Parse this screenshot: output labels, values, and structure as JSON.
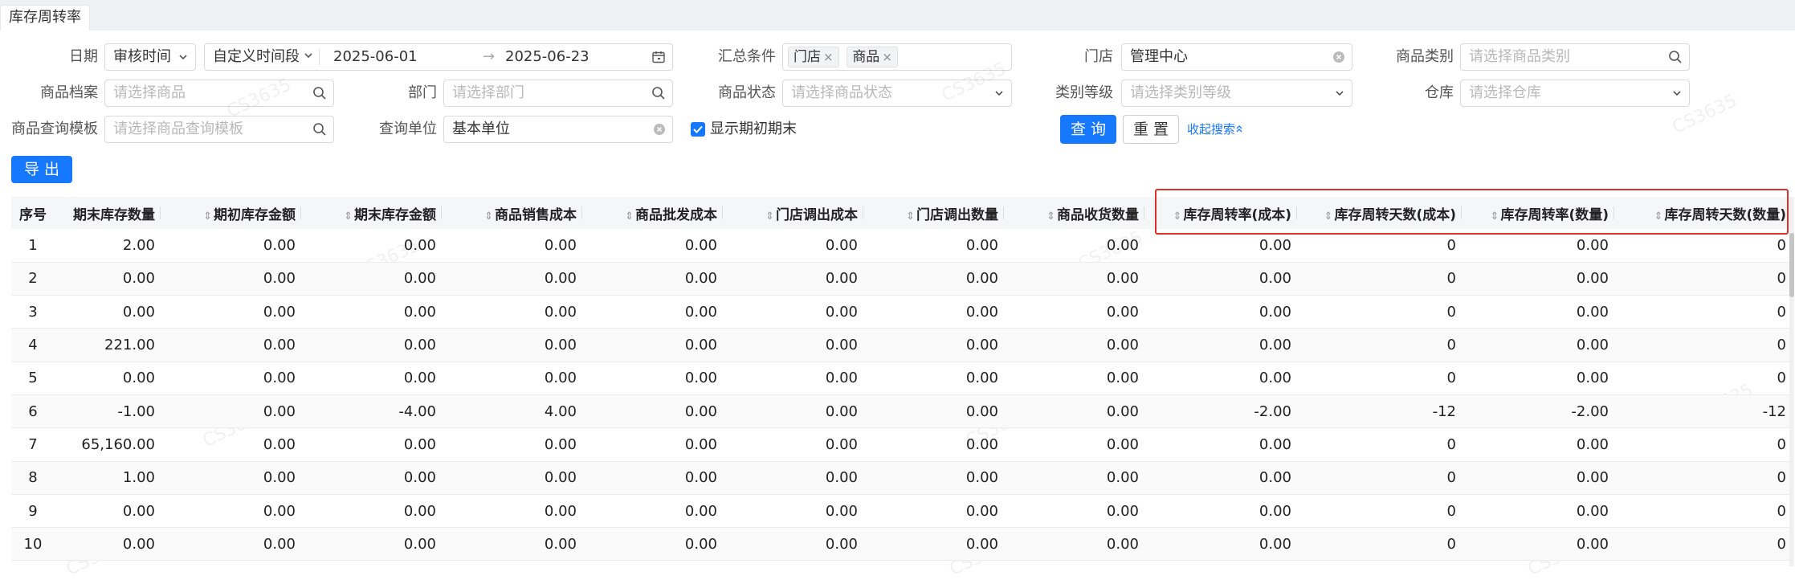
{
  "tab": {
    "title": "库存周转率"
  },
  "filters": {
    "date_label": "日期",
    "date_type": "审核时间",
    "date_range_mode": "自定义时间段",
    "start_date": "2025-06-01",
    "end_date": "2025-06-23",
    "summary_label": "汇总条件",
    "summary_tags": [
      "门店",
      "商品"
    ],
    "store_label": "门店",
    "store_value": "管理中心",
    "category_label": "商品类别",
    "category_placeholder": "请选择商品类别",
    "product_label": "商品档案",
    "product_placeholder": "请选择商品",
    "dept_label": "部门",
    "dept_placeholder": "请选择部门",
    "status_label": "商品状态",
    "status_placeholder": "请选择商品状态",
    "level_label": "类别等级",
    "level_placeholder": "请选择类别等级",
    "warehouse_label": "仓库",
    "warehouse_placeholder": "请选择仓库",
    "template_label": "商品查询模板",
    "template_placeholder": "请选择商品查询模板",
    "unit_label": "查询单位",
    "unit_value": "基本单位",
    "show_period_label": "显示期初期末",
    "show_period_checked": true
  },
  "actions": {
    "query": "查 询",
    "reset": "重 置",
    "collapse": "收起搜索",
    "export": "导 出"
  },
  "table": {
    "columns": [
      "序号",
      "期末库存数量",
      "期初库存金额",
      "期末库存金额",
      "商品销售成本",
      "商品批发成本",
      "门店调出成本",
      "门店调出数量",
      "商品收货数量",
      "库存周转率(成本)",
      "库存周转天数(成本)",
      "库存周转率(数量)",
      "库存周转天数(数量)"
    ],
    "rows": [
      [
        "1",
        "2.00",
        "0.00",
        "0.00",
        "0.00",
        "0.00",
        "0.00",
        "0.00",
        "0.00",
        "0.00",
        "0",
        "0.00",
        "0"
      ],
      [
        "2",
        "0.00",
        "0.00",
        "0.00",
        "0.00",
        "0.00",
        "0.00",
        "0.00",
        "0.00",
        "0.00",
        "0",
        "0.00",
        "0"
      ],
      [
        "3",
        "0.00",
        "0.00",
        "0.00",
        "0.00",
        "0.00",
        "0.00",
        "0.00",
        "0.00",
        "0.00",
        "0",
        "0.00",
        "0"
      ],
      [
        "4",
        "221.00",
        "0.00",
        "0.00",
        "0.00",
        "0.00",
        "0.00",
        "0.00",
        "0.00",
        "0.00",
        "0",
        "0.00",
        "0"
      ],
      [
        "5",
        "0.00",
        "0.00",
        "0.00",
        "0.00",
        "0.00",
        "0.00",
        "0.00",
        "0.00",
        "0.00",
        "0",
        "0.00",
        "0"
      ],
      [
        "6",
        "-1.00",
        "0.00",
        "-4.00",
        "4.00",
        "0.00",
        "0.00",
        "0.00",
        "0.00",
        "-2.00",
        "-12",
        "-2.00",
        "-12"
      ],
      [
        "7",
        "65,160.00",
        "0.00",
        "0.00",
        "0.00",
        "0.00",
        "0.00",
        "0.00",
        "0.00",
        "0.00",
        "0",
        "0.00",
        "0"
      ],
      [
        "8",
        "1.00",
        "0.00",
        "0.00",
        "0.00",
        "0.00",
        "0.00",
        "0.00",
        "0.00",
        "0.00",
        "0",
        "0.00",
        "0"
      ],
      [
        "9",
        "0.00",
        "0.00",
        "0.00",
        "0.00",
        "0.00",
        "0.00",
        "0.00",
        "0.00",
        "0.00",
        "0",
        "0.00",
        "0"
      ],
      [
        "10",
        "0.00",
        "0.00",
        "0.00",
        "0.00",
        "0.00",
        "0.00",
        "0.00",
        "0.00",
        "0.00",
        "0",
        "0.00",
        "0"
      ]
    ]
  },
  "watermark": "CS3635",
  "colors": {
    "primary": "#1677ff",
    "highlight": "#e0302a",
    "header_bg": "#f5f6f8"
  }
}
